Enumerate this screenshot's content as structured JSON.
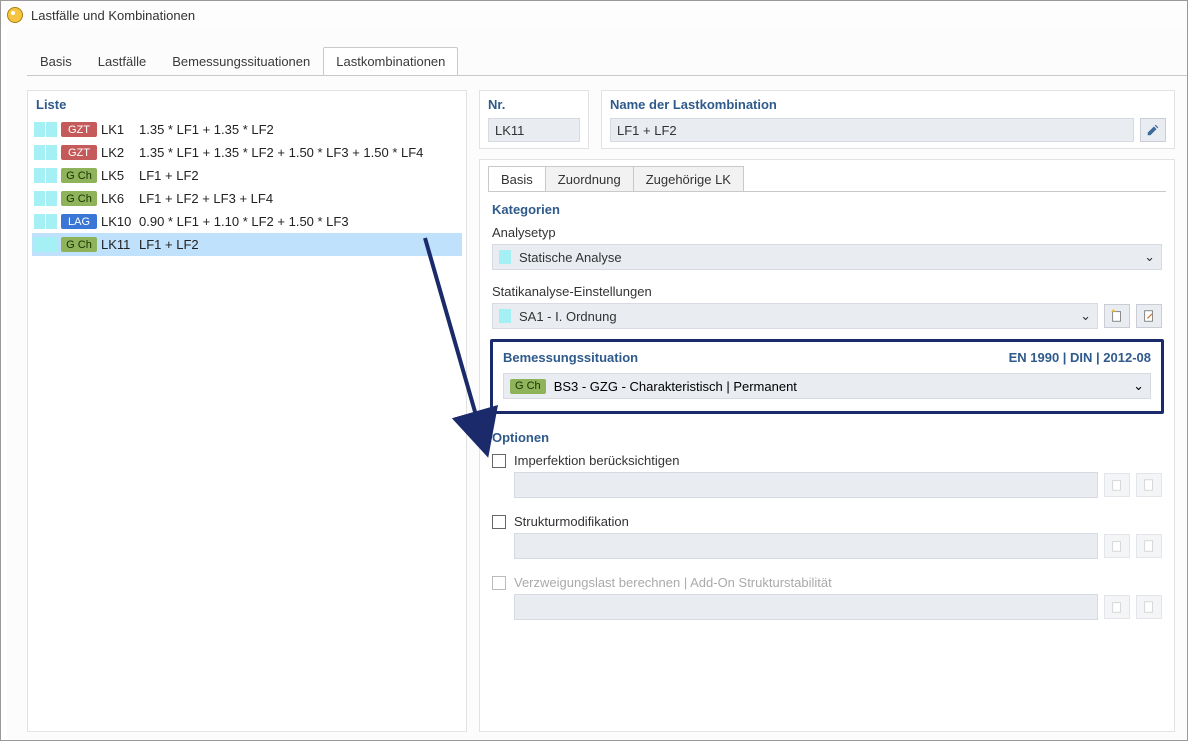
{
  "window_title": "Lastfälle und Kombinationen",
  "tabs": [
    "Basis",
    "Lastfälle",
    "Bemessungssituationen",
    "Lastkombinationen"
  ],
  "active_tab_index": 3,
  "liste_title": "Liste",
  "list": [
    {
      "badge": "GZT",
      "badge_cls": "gzt",
      "id": "LK1",
      "name": "1.35 * LF1 + 1.35 * LF2"
    },
    {
      "badge": "GZT",
      "badge_cls": "gzt",
      "id": "LK2",
      "name": "1.35 * LF1 + 1.35 * LF2 + 1.50 * LF3 + 1.50 * LF4"
    },
    {
      "badge": "G Ch",
      "badge_cls": "gch",
      "id": "LK5",
      "name": "LF1 + LF2"
    },
    {
      "badge": "G Ch",
      "badge_cls": "gch",
      "id": "LK6",
      "name": "LF1 + LF2 + LF3 + LF4"
    },
    {
      "badge": "LAG",
      "badge_cls": "lag",
      "id": "LK10",
      "name": "0.90 * LF1 + 1.10 * LF2 + 1.50 * LF3"
    },
    {
      "badge": "G Ch",
      "badge_cls": "gch",
      "id": "LK11",
      "name": "LF1 + LF2",
      "selected": true
    }
  ],
  "nr_label": "Nr.",
  "nr_value": "LK11",
  "name_label": "Name der Lastkombination",
  "name_value": "LF1 + LF2",
  "sub_tabs": [
    "Basis",
    "Zuordnung",
    "Zugehörige LK"
  ],
  "active_sub_tab_index": 0,
  "kategorien_title": "Kategorien",
  "analysetyp_label": "Analysetyp",
  "analysetyp_value": "Statische Analyse",
  "statik_label": "Statikanalyse-Einstellungen",
  "statik_value": "SA1 - I. Ordnung",
  "design_title": "Bemessungssituation",
  "design_norm": "EN 1990 | DIN | 2012-08",
  "design_badge": "G Ch",
  "design_value": "BS3 - GZG - Charakteristisch | Permanent",
  "optionen_title": "Optionen",
  "opt_imperf": "Imperfektion berücksichtigen",
  "opt_struct": "Strukturmodifikation",
  "opt_branch": "Verzweigungslast berechnen | Add-On Strukturstabilität"
}
